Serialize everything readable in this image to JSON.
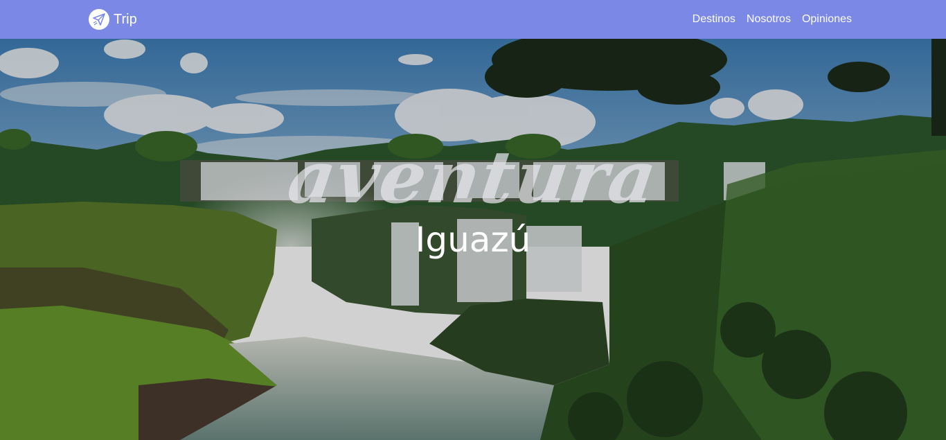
{
  "navbar": {
    "brand_name": "Trip",
    "brand_icon": "paper-plane-icon",
    "background_color": "#7b88e6",
    "links": [
      {
        "label": "Destinos"
      },
      {
        "label": "Nosotros"
      },
      {
        "label": "Opiniones"
      }
    ]
  },
  "hero": {
    "script_title": "aventura",
    "subtitle": "Iguazú"
  }
}
